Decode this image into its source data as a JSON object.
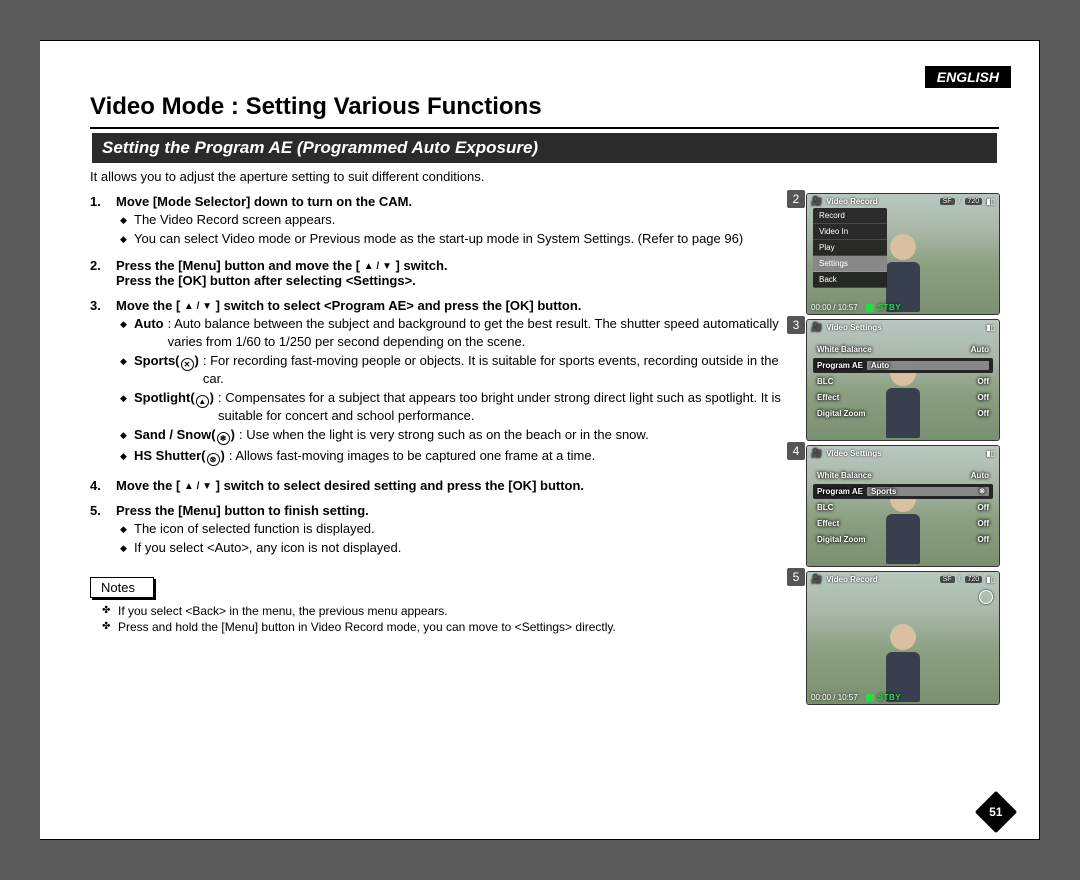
{
  "lang_label": "ENGLISH",
  "page_title": "Video Mode : Setting Various Functions",
  "section_heading": "Setting the Program AE (Programmed Auto Exposure)",
  "intro": "It allows you to adjust the aperture setting to suit different conditions.",
  "steps": {
    "s1": {
      "num": "1.",
      "title": "Move [Mode Selector] down to turn on the CAM.",
      "b1": "The Video Record screen appears.",
      "b2": "You can select Video mode or Previous mode as the start-up mode in System Settings. (Refer to page 96)"
    },
    "s2": {
      "num": "2.",
      "title_a": "Press the [Menu] button and move the [ ",
      "title_b": " ] switch.",
      "title_c": "Press the [OK] button after selecting <Settings>."
    },
    "s3": {
      "num": "3.",
      "title_a": "Move the [ ",
      "title_b": " ] switch to select <Program AE> and press the [OK] button.",
      "defs": {
        "auto": {
          "term": "Auto",
          "desc": ": Auto balance between the subject and background to get the best result. The shutter speed automatically varies from 1/60 to 1/250 per second depending on the scene."
        },
        "sports": {
          "term": "Sports(",
          "term2": ")",
          "desc": ": For recording fast-moving people or objects. It is suitable for sports events, recording outside in the car."
        },
        "spotlight": {
          "term": "Spotlight(",
          "term2": ")",
          "desc": ": Compensates for a subject that appears too bright under strong direct light such as spotlight. It is suitable for concert and school performance."
        },
        "sandsnow": {
          "term": "Sand / Snow(",
          "term2": ")",
          "desc": ": Use when the light is very strong such as on the beach or in the snow."
        },
        "hsshutter": {
          "term": "HS Shutter(",
          "term2": ")",
          "desc": ": Allows fast-moving images to be captured one frame at a time."
        }
      }
    },
    "s4": {
      "num": "4.",
      "title_a": "Move the [ ",
      "title_b": " ] switch to select desired setting and press the [OK] button."
    },
    "s5": {
      "num": "5.",
      "title": "Press the [Menu] button to finish setting.",
      "b1": "The icon of selected function is displayed.",
      "b2": "If you select <Auto>, any icon is not displayed."
    }
  },
  "notes_label": "Notes",
  "notes": {
    "n1": "If you select <Back> in the menu, the previous menu appears.",
    "n2": "Press and hold the [Menu] button in Video Record mode, you can move to <Settings> directly."
  },
  "screens": {
    "sc2": {
      "num": "2",
      "top_title": "Video Record",
      "pill_sf": "SF",
      "pill_720": "720",
      "menu": {
        "m1": "Record",
        "m2": "Video In",
        "m3": "Play",
        "m4": "Settings",
        "m5": "Back"
      },
      "time": "00:00 / 10:57",
      "stby": "STBY"
    },
    "sc3": {
      "num": "3",
      "top_title": "Video Settings",
      "rows": {
        "r1": {
          "lbl": "White Balance",
          "val": "Auto"
        },
        "r2": {
          "lbl": "Program AE",
          "val": "Auto"
        },
        "r3": {
          "lbl": "BLC",
          "val": "Off"
        },
        "r4": {
          "lbl": "Effect",
          "val": "Off"
        },
        "r5": {
          "lbl": "Digital Zoom",
          "val": "Off"
        }
      }
    },
    "sc4": {
      "num": "4",
      "top_title": "Video Settings",
      "rows": {
        "r1": {
          "lbl": "White Balance",
          "val": "Auto"
        },
        "r2": {
          "lbl": "Program AE",
          "val": "Sports"
        },
        "r3": {
          "lbl": "BLC",
          "val": "Off"
        },
        "r4": {
          "lbl": "Effect",
          "val": "Off"
        },
        "r5": {
          "lbl": "Digital Zoom",
          "val": "Off"
        }
      }
    },
    "sc5": {
      "num": "5",
      "top_title": "Video Record",
      "pill_sf": "SF",
      "pill_720": "720",
      "time": "00:00 / 10:57",
      "stby": "STBY"
    }
  },
  "page_number": "51"
}
